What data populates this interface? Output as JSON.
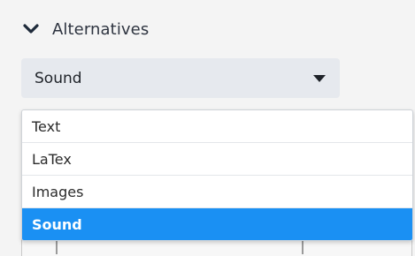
{
  "section": {
    "title": "Alternatives",
    "toggle_icon": "chevron-down-icon"
  },
  "select": {
    "value": "Sound",
    "caret_icon": "caret-down-icon"
  },
  "dropdown": {
    "options": [
      {
        "label": "Text",
        "selected": false
      },
      {
        "label": "LaTex",
        "selected": false
      },
      {
        "label": "Images",
        "selected": false
      },
      {
        "label": "Sound",
        "selected": true
      }
    ]
  },
  "colors": {
    "selected_background": "#1a90f3",
    "select_background": "#e6e9ee",
    "text": "#2b2b2b"
  }
}
